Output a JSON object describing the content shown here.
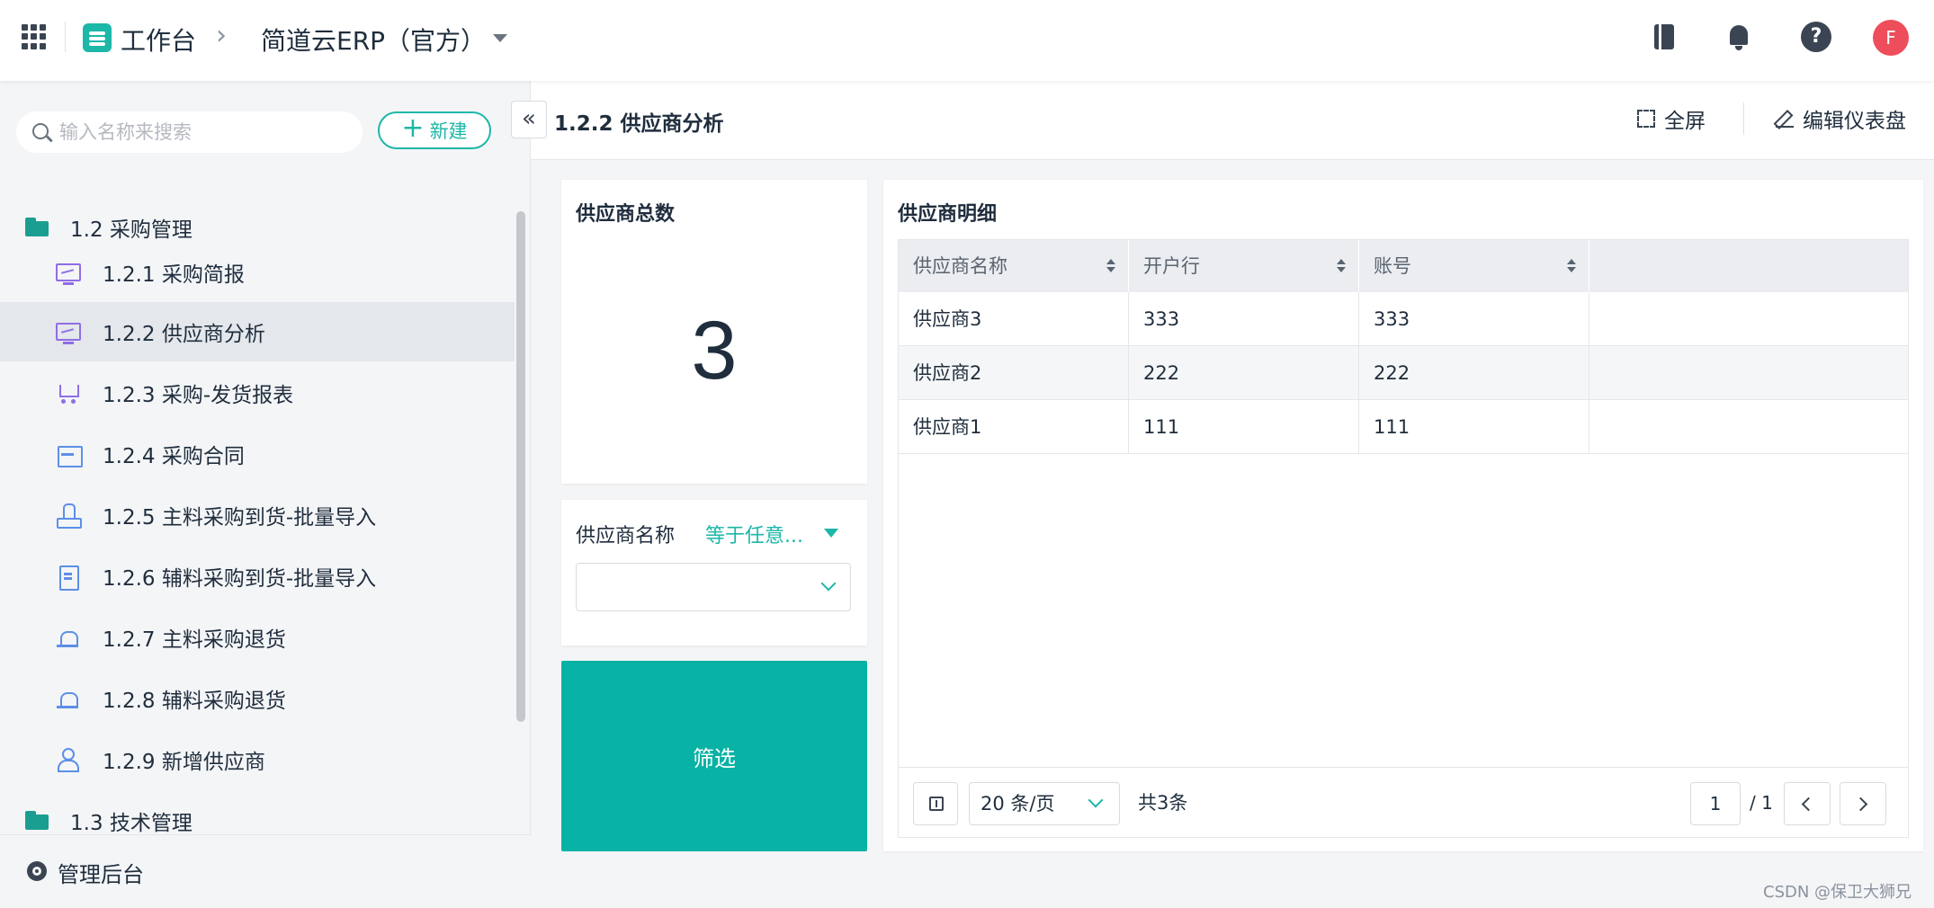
{
  "topbar": {
    "workbench": "工作台",
    "crumb_sep": "›",
    "app_name": "简道云ERP（官方）",
    "avatar_letter": "F",
    "help_glyph": "?"
  },
  "sidebar": {
    "search_placeholder": "输入名称来搜索",
    "new_button": "新建",
    "new_plus": "+",
    "items": [
      {
        "label": "1.2 采购管理",
        "icon": "folder-icon"
      },
      {
        "label": "1.2.1 采购简报",
        "icon": "monitor-icon"
      },
      {
        "label": "1.2.2 供应商分析",
        "icon": "monitor-icon"
      },
      {
        "label": "1.2.3 采购-发货报表",
        "icon": "cart-icon"
      },
      {
        "label": "1.2.4 采购合同",
        "icon": "contract-icon"
      },
      {
        "label": "1.2.5 主料采购到货-批量导入",
        "icon": "stamp-icon"
      },
      {
        "label": "1.2.6 辅料采购到货-批量导入",
        "icon": "doc-icon"
      },
      {
        "label": "1.2.7 主料采购退货",
        "icon": "alarm-icon"
      },
      {
        "label": "1.2.8 辅料采购退货",
        "icon": "alarm-icon"
      },
      {
        "label": "1.2.9 新增供应商",
        "icon": "user-icon"
      },
      {
        "label": "1.3 技术管理",
        "icon": "folder-icon"
      }
    ],
    "admin_label": "管理后台",
    "collapse_glyph": "«"
  },
  "header": {
    "title": "1.2.2 供应商分析",
    "fullscreen": "全屏",
    "edit_dashboard": "编辑仪表盘"
  },
  "count_card": {
    "title": "供应商总数",
    "value": "3"
  },
  "filter": {
    "field_label": "供应商名称",
    "operator": "等于任意...",
    "value": ""
  },
  "filter_button": "筛选",
  "table": {
    "title": "供应商明细",
    "columns": [
      "供应商名称",
      "开户行",
      "账号",
      ""
    ],
    "rows": [
      [
        "供应商3",
        "333",
        "333",
        ""
      ],
      [
        "供应商2",
        "222",
        "222",
        ""
      ],
      [
        "供应商1",
        "111",
        "111",
        ""
      ]
    ],
    "page_size": "20 条/页",
    "total": "共3条",
    "current_page": "1",
    "page_total": "/ 1"
  },
  "watermark": "CSDN @保卫大狮兄",
  "colors": {
    "accent": "#1db7a8",
    "filter_button": "#08b2a4",
    "avatar": "#ee4d5b"
  }
}
